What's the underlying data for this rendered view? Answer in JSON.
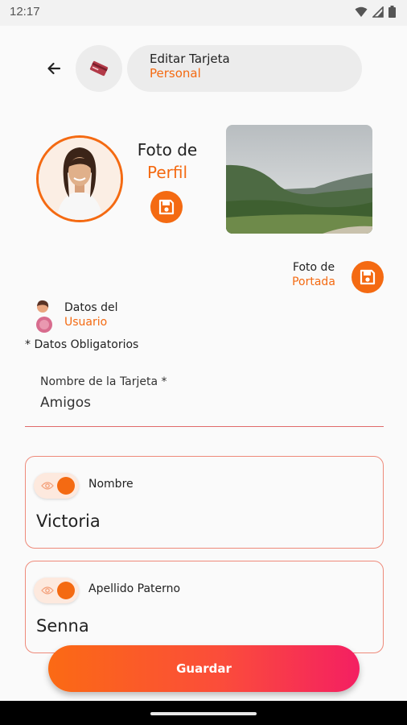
{
  "status_bar": {
    "time": "12:17"
  },
  "header": {
    "title_line1": "Editar Tarjeta",
    "title_line2": "Personal"
  },
  "profile_photo": {
    "label_line1": "Foto de",
    "label_line2": "Perfil"
  },
  "cover_photo": {
    "label_line1": "Foto de",
    "label_line2": "Portada"
  },
  "user_section": {
    "label_line1": "Datos del",
    "label_line2": "Usuario"
  },
  "required_note": "* Datos Obligatorios",
  "card_name_field": {
    "label": "Nombre de la Tarjeta *",
    "value": "Amigos"
  },
  "fields": [
    {
      "label": "Nombre",
      "value": "Victoria",
      "visible": true
    },
    {
      "label": "Apellido Paterno",
      "value": "Senna",
      "visible": true
    }
  ],
  "save_button": "Guardar",
  "colors": {
    "accent": "#f46a12",
    "gradient_start": "#fb6a14",
    "gradient_end": "#f41f62"
  }
}
